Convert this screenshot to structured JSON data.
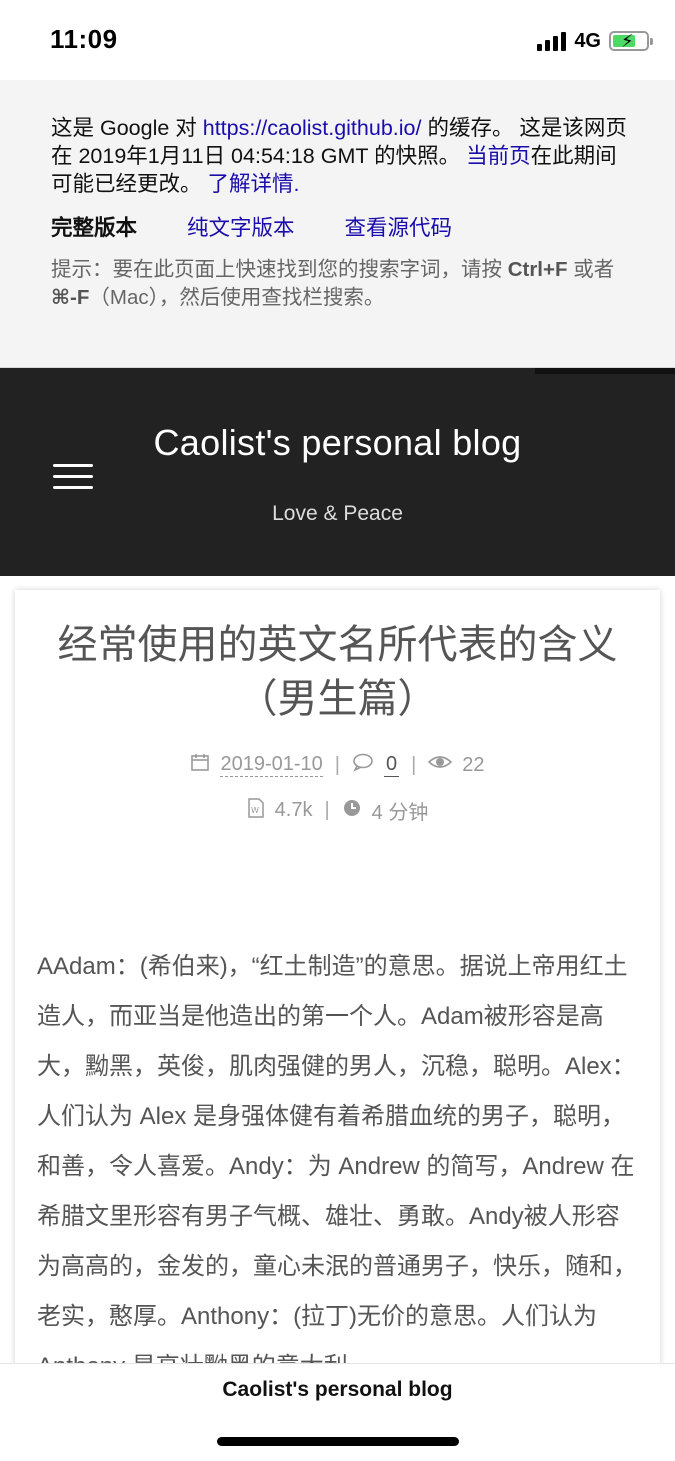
{
  "status_bar": {
    "time": "11:09",
    "network": "4G",
    "battery_icon": "battery-charging-icon",
    "battery_color": "#4cd964"
  },
  "cache_banner": {
    "line_prefix": "这是 Google 对 ",
    "url": "https://caolist.github.io/",
    "line_mid": " 的缓存。 这是该网页在 2019年1月11日 04:54:18 GMT 的快照。",
    "current_page_link": "当前页",
    "line_suffix": "在此期间可能已经更改。",
    "learn_more": "了解详情.",
    "links": {
      "full_version": "完整版本",
      "text_version": "纯文字版本",
      "view_source": "查看源代码"
    },
    "tip_prefix": "提示：要在此页面上快速找到您的搜索字词，请按 ",
    "tip_key1": "Ctrl+F",
    "tip_mid": " 或者 ",
    "tip_key2": "⌘-F",
    "tip_suffix": "（Mac），然后使用查找栏搜索。"
  },
  "header": {
    "title": "Caolist's personal blog",
    "subtitle": "Love & Peace",
    "background": "#222222"
  },
  "article": {
    "title": "经常使用的英文名所代表的含义（男生篇）",
    "date": "2019-01-10",
    "comments": "0",
    "views": "22",
    "word_count": "4.7k",
    "reading_time": "4 分钟",
    "body": "AAdam：(希伯来)，“红土制造”的意思。据说上帝用红土造人，而亚当是他造出的第一个人。Adam被形容是高大，黝黑，英俊，肌肉强健的男人，沉稳，聪明。Alex：人们认为 Alex 是身强体健有着希腊血统的男子，聪明，和善，令人喜爱。Andy：为 Andrew 的简写，Andrew 在希腊文里形容有男子气概、雄壮、勇敢。Andy被人形容为高高的，金发的，童心未泯的普通男子，快乐，随和，老实，憨厚。Anthony：(拉丁)无价的意思。人们认为 Anthony 是高壮黝黑的意大利"
  },
  "bottom_bar": {
    "title": "Caolist's personal blog"
  }
}
